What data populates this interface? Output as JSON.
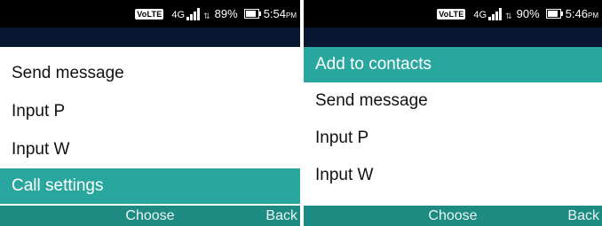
{
  "screens": [
    {
      "status": {
        "volte": "VoLTE",
        "network": "4G",
        "battery_pct": "89%",
        "battery_level": 0.89,
        "time": "5:54",
        "ampm": "PM"
      },
      "menu": [
        {
          "label": "Send message",
          "selected": false
        },
        {
          "label": "Input P",
          "selected": false
        },
        {
          "label": "Input W",
          "selected": false
        },
        {
          "label": "Call settings",
          "selected": true
        }
      ],
      "softkeys": {
        "center": "Choose",
        "right": "Back"
      }
    },
    {
      "status": {
        "volte": "VoLTE",
        "network": "4G",
        "battery_pct": "90%",
        "battery_level": 0.9,
        "time": "5:46",
        "ampm": "PM"
      },
      "menu": [
        {
          "label": "Add to contacts",
          "selected": true
        },
        {
          "label": "Send message",
          "selected": false
        },
        {
          "label": "Input P",
          "selected": false
        },
        {
          "label": "Input W",
          "selected": false
        }
      ],
      "softkeys": {
        "center": "Choose",
        "right": "Back"
      }
    }
  ],
  "colors": {
    "accent": "#29a79e",
    "softkey_bar": "#1e8b82",
    "title_bar": "#0a1733",
    "status_bar": "#000000"
  }
}
